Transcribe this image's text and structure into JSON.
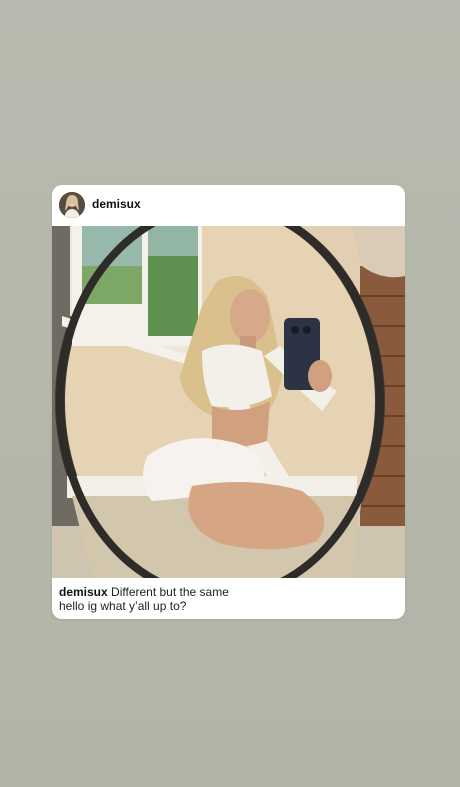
{
  "post": {
    "username": "demisux",
    "caption_username": "demisux",
    "caption_line1": "Different but the same",
    "caption_line2": "hello ig what y’all up to?"
  },
  "icons": {
    "avatar": "profile-avatar"
  },
  "colors": {
    "background": "#b7b8ac",
    "card": "#ffffff",
    "text": "#111111"
  }
}
